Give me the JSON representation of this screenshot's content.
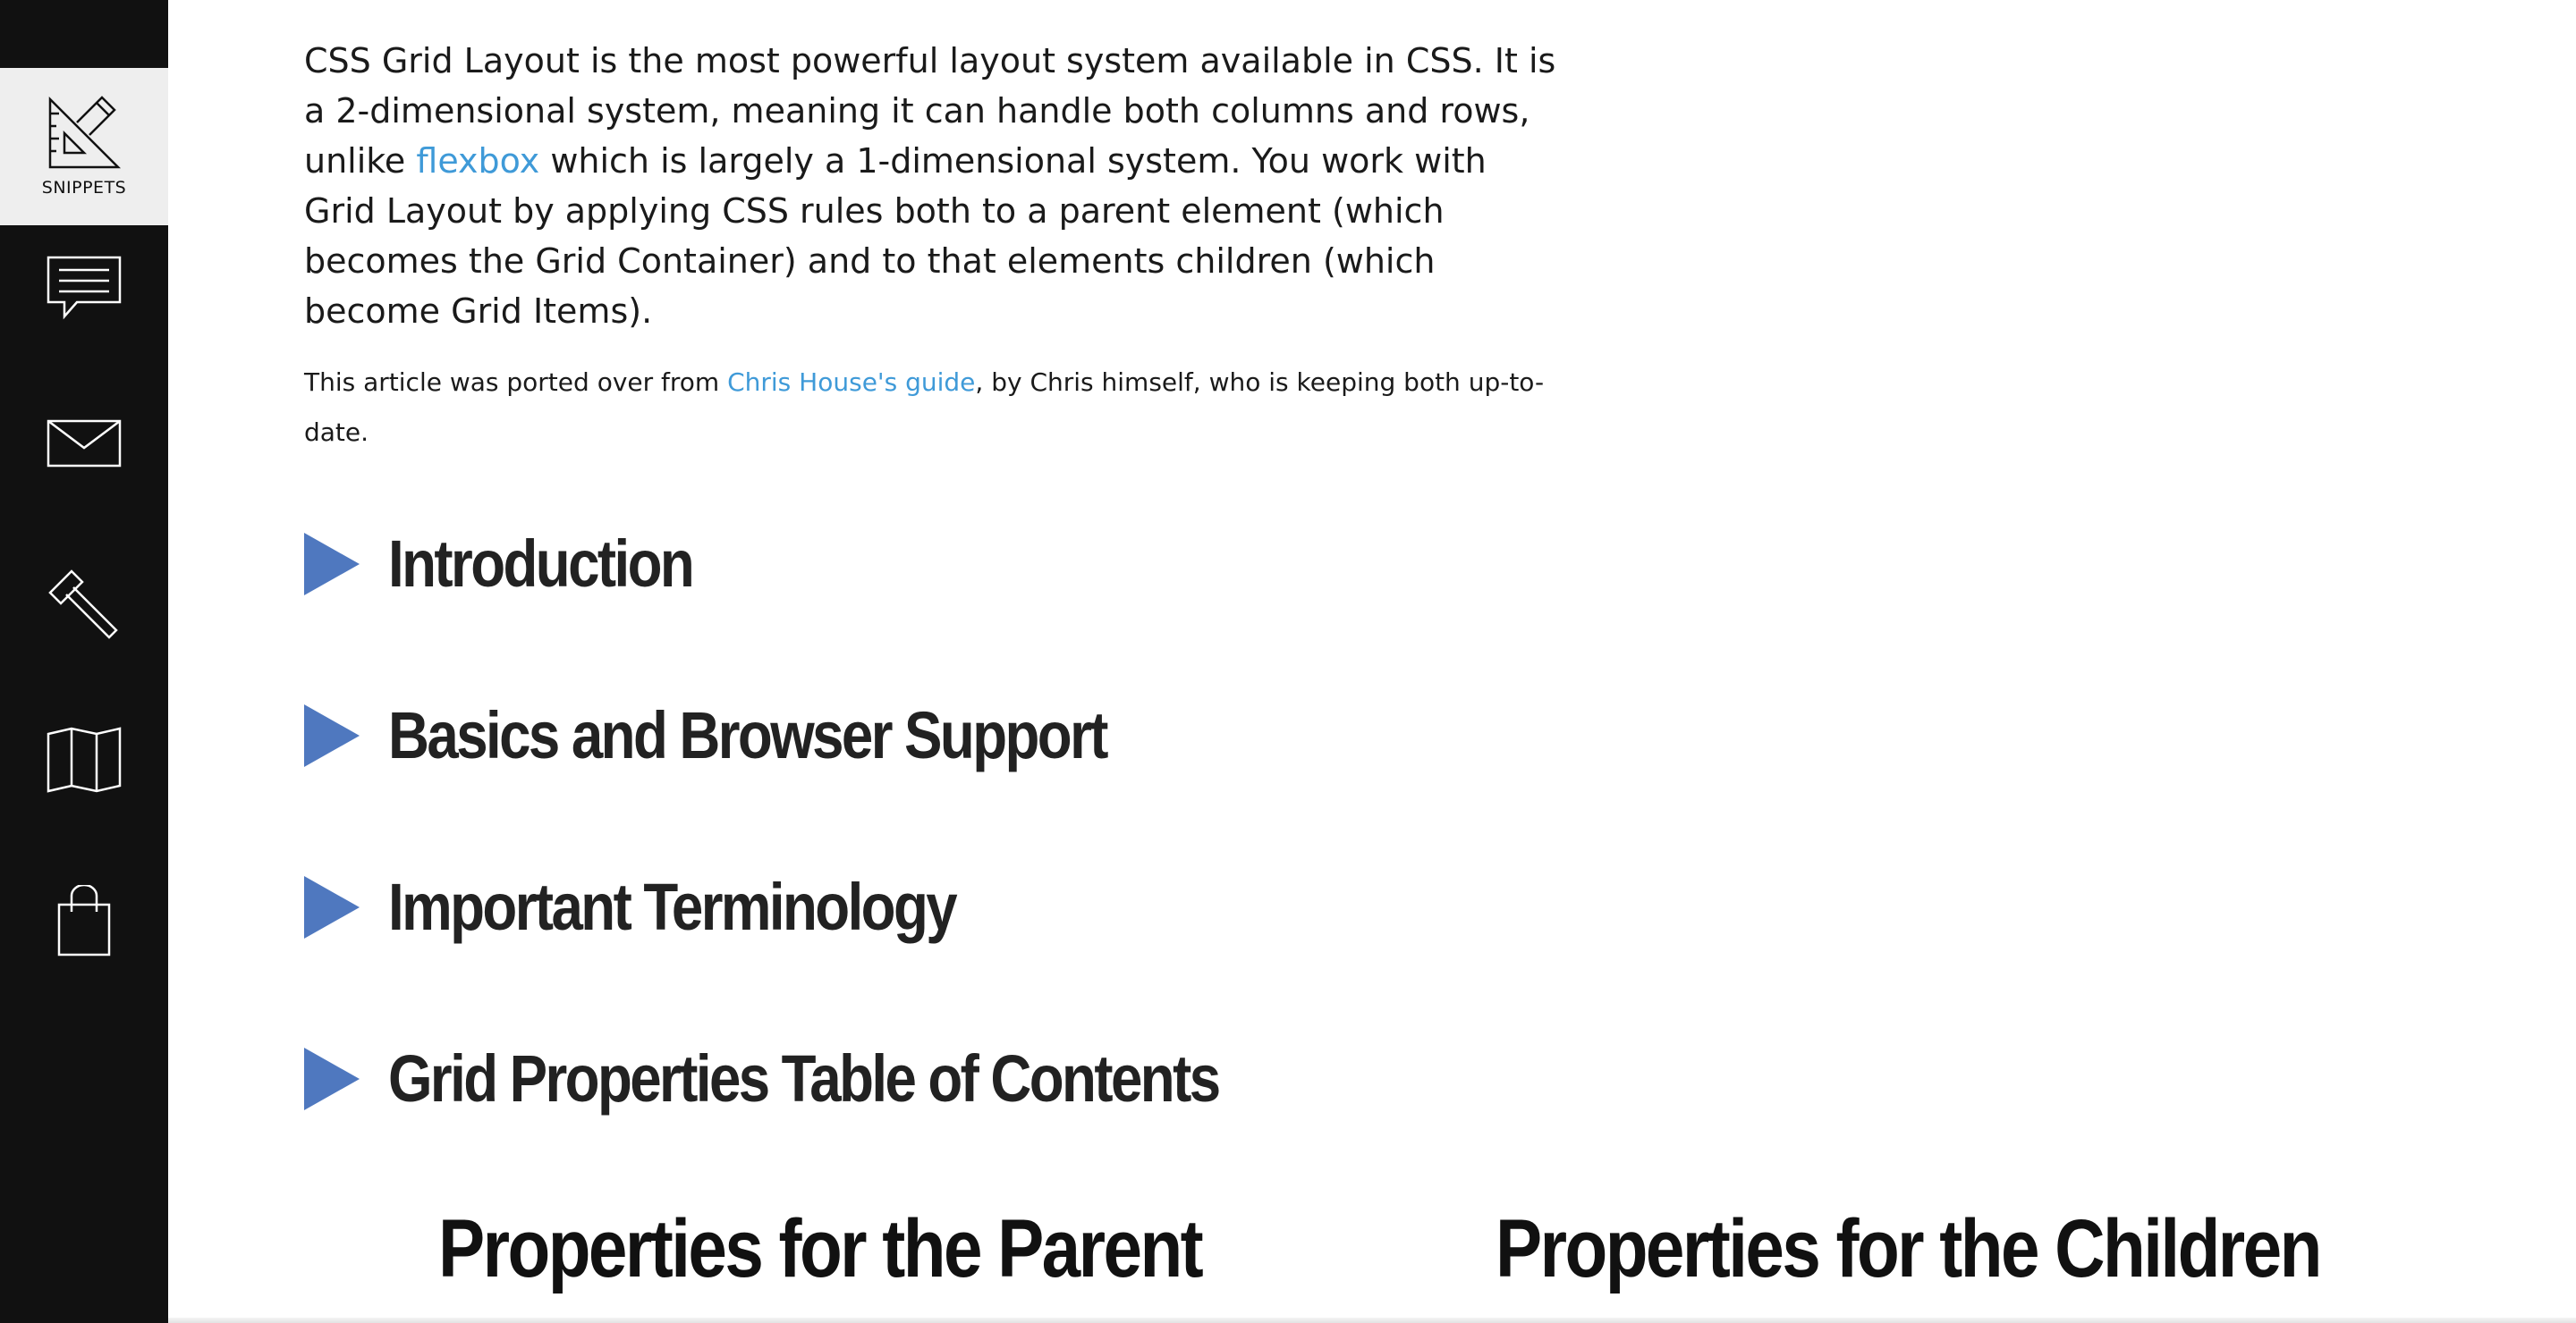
{
  "sidebar": {
    "items": [
      {
        "icon": "ruler-pencil-icon",
        "label": "SNIPPETS",
        "active": true
      },
      {
        "icon": "speech-bubble-icon",
        "label": ""
      },
      {
        "icon": "envelope-icon",
        "label": ""
      },
      {
        "icon": "hammer-icon",
        "label": ""
      },
      {
        "icon": "map-icon",
        "label": ""
      },
      {
        "icon": "shopping-bag-icon",
        "label": ""
      }
    ]
  },
  "article": {
    "intro_part1": "CSS Grid Layout is the most powerful layout system available in CSS. It is a 2-dimensional system, meaning it can handle both columns and rows, unlike ",
    "intro_link": "flexbox",
    "intro_part2": " which is largely a 1-dimensional system. You work with Grid Layout by applying CSS rules both to a parent element (which becomes the Grid Container) and to that elements children (which become Grid Items).",
    "note_part1": "This article was ported over from ",
    "note_link": "Chris House's guide",
    "note_part2": ", by Chris himself, who is keeping both up-to-date."
  },
  "sections": [
    {
      "title": "Introduction"
    },
    {
      "title": "Basics and Browser Support"
    },
    {
      "title": "Important Terminology"
    },
    {
      "title": "Grid Properties Table of Contents"
    }
  ],
  "columns": {
    "parent_heading": "Properties for the Parent",
    "children_heading": "Properties for the Children"
  },
  "colors": {
    "sidebar_bg": "#111111",
    "link": "#3f9ad8",
    "toggle_triangle": "#4f78bf"
  }
}
